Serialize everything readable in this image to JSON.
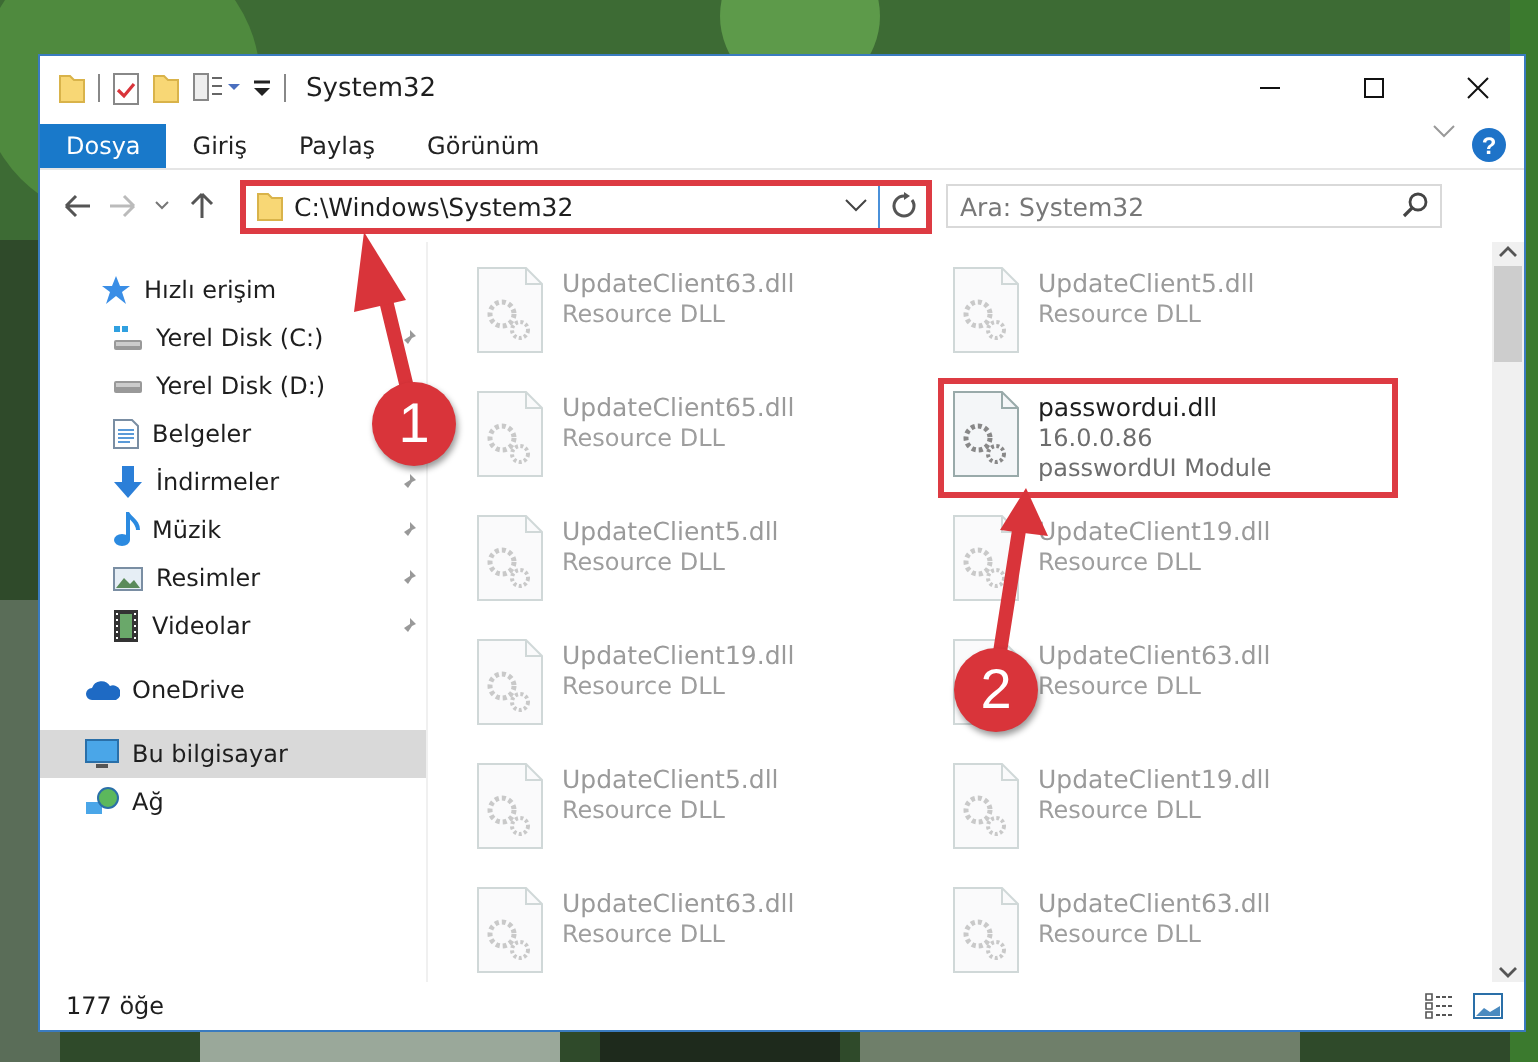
{
  "window": {
    "title": "System32"
  },
  "ribbon_tabs": [
    {
      "label": "Dosya",
      "selected": true
    },
    {
      "label": "Giriş",
      "selected": false
    },
    {
      "label": "Paylaş",
      "selected": false
    },
    {
      "label": "Görünüm",
      "selected": false
    }
  ],
  "help_button": "?",
  "address_bar": {
    "value": "C:\\Windows\\System32",
    "highlighted": true
  },
  "search": {
    "placeholder": "Ara: System32"
  },
  "navigation": [
    {
      "label": "Hızlı erişim",
      "kind": "quick",
      "selected": false,
      "children": [
        {
          "label": "Yerel Disk (C:)",
          "kind": "drive-c",
          "pinned": true,
          "selected": false
        },
        {
          "label": "Yerel Disk (D:)",
          "kind": "drive",
          "pinned": false,
          "selected": false
        },
        {
          "label": "Belgeler",
          "kind": "documents",
          "pinned": false,
          "selected": false
        },
        {
          "label": "İndirmeler",
          "kind": "downloads",
          "pinned": true,
          "selected": false
        },
        {
          "label": "Müzik",
          "kind": "music",
          "pinned": true,
          "selected": false
        },
        {
          "label": "Resimler",
          "kind": "pictures",
          "pinned": true,
          "selected": false
        },
        {
          "label": "Videolar",
          "kind": "videos",
          "pinned": true,
          "selected": false
        }
      ]
    },
    {
      "label": "OneDrive",
      "kind": "cloud",
      "selected": false
    },
    {
      "label": "Bu bilgisayar",
      "kind": "computer",
      "selected": true
    },
    {
      "label": "Ağ",
      "kind": "network",
      "selected": false
    }
  ],
  "files": [
    {
      "name": "UpdateClient63.dll",
      "type": "Resource DLL",
      "blurred": true,
      "highlighted": false
    },
    {
      "name": "UpdateClient5.dll",
      "type": "Resource DLL",
      "blurred": true,
      "highlighted": false
    },
    {
      "name": "UpdateClient65.dll",
      "type": "Resource DLL",
      "blurred": true,
      "highlighted": false
    },
    {
      "name": "passwordui.dll",
      "version": "16.0.0.86",
      "type": "passwordUI Module",
      "blurred": false,
      "highlighted": true
    },
    {
      "name": "UpdateClient5.dll",
      "type": "Resource DLL",
      "blurred": true,
      "highlighted": false
    },
    {
      "name": "UpdateClient19.dll",
      "type": "Resource DLL",
      "blurred": true,
      "highlighted": false
    },
    {
      "name": "UpdateClient19.dll",
      "type": "Resource DLL",
      "blurred": true,
      "highlighted": false
    },
    {
      "name": "UpdateClient63.dll",
      "type": "Resource DLL",
      "blurred": true,
      "highlighted": false
    },
    {
      "name": "UpdateClient5.dll",
      "type": "Resource DLL",
      "blurred": true,
      "highlighted": false
    },
    {
      "name": "UpdateClient19.dll",
      "type": "Resource DLL",
      "blurred": true,
      "highlighted": false
    },
    {
      "name": "UpdateClient63.dll",
      "type": "Resource DLL",
      "blurred": true,
      "highlighted": false
    },
    {
      "name": "UpdateClient63.dll",
      "type": "Resource DLL",
      "blurred": true,
      "highlighted": false
    }
  ],
  "status_bar": {
    "item_count": "177 öğe"
  },
  "annotations": [
    {
      "number": "1"
    },
    {
      "number": "2"
    }
  ]
}
